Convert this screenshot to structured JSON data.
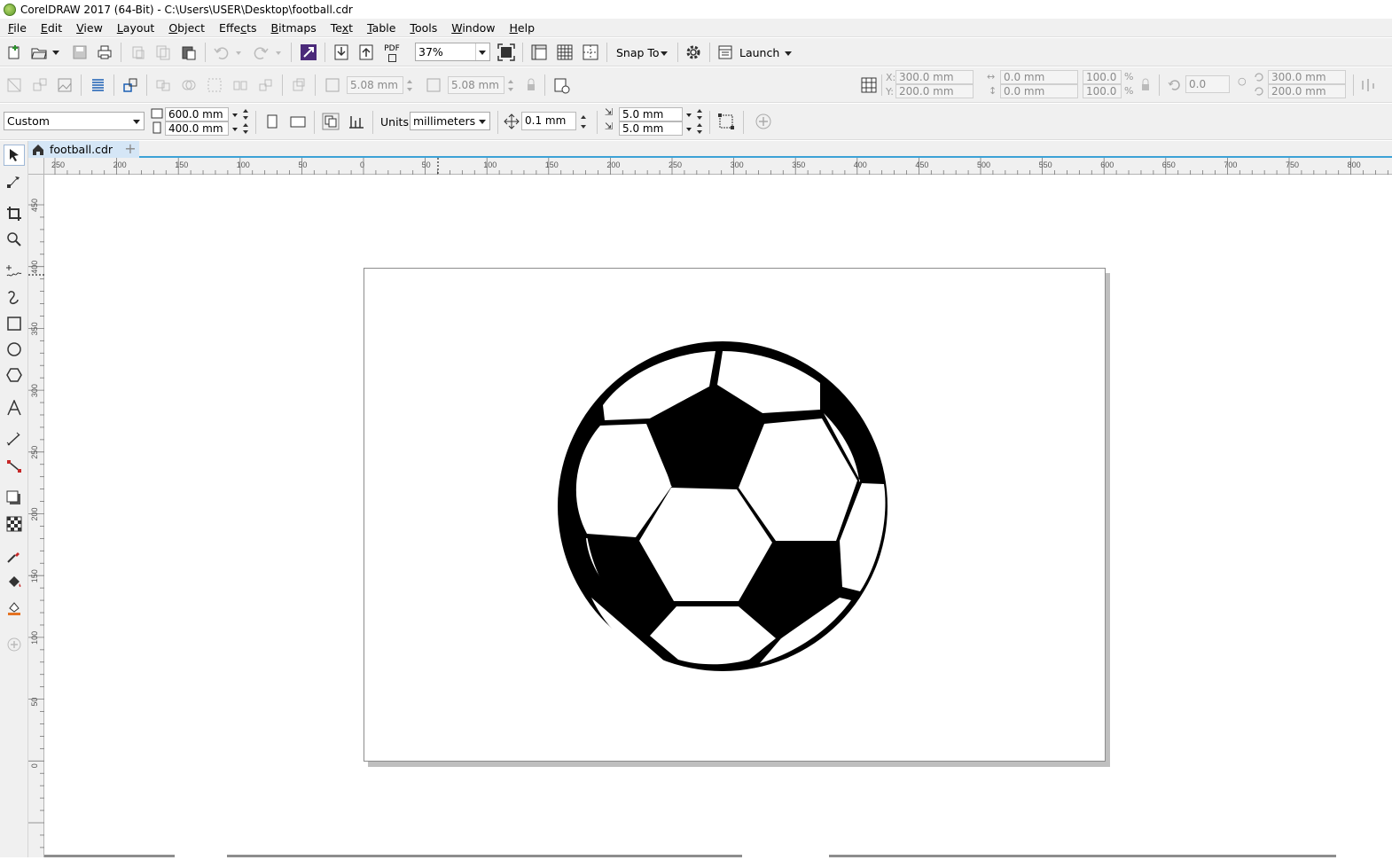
{
  "titlebar": {
    "title": "CorelDRAW 2017 (64-Bit) - C:\\Users\\USER\\Desktop\\football.cdr"
  },
  "menu": [
    {
      "label": "File",
      "u": "F",
      "rest": "ile"
    },
    {
      "label": "Edit",
      "u": "E",
      "rest": "dit"
    },
    {
      "label": "View",
      "u": "V",
      "rest": "iew"
    },
    {
      "label": "Layout",
      "u": "L",
      "rest": "ayout"
    },
    {
      "label": "Object",
      "u": "O",
      "rest": "bject"
    },
    {
      "label": "Effects",
      "u": "E",
      "rest": "ffects",
      "pre": ""
    },
    {
      "label": "Bitmaps",
      "u": "B",
      "rest": "itmaps"
    },
    {
      "label": "Text",
      "u": "T",
      "rest": "ext",
      "pre": "Te",
      "post": "t"
    },
    {
      "label": "Table",
      "u": "T",
      "rest": "able"
    },
    {
      "label": "Tools",
      "u": "T",
      "rest": "ools"
    },
    {
      "label": "Window",
      "u": "W",
      "rest": "indow"
    },
    {
      "label": "Help",
      "u": "H",
      "rest": "elp"
    }
  ],
  "standard_toolbar": {
    "pdf_label": "PDF",
    "zoom": "37%",
    "snap_to": "Snap To",
    "launch": "Launch"
  },
  "property_bar": {
    "nudge_h": "5.08 mm",
    "nudge_v": "5.08 mm",
    "x_label": "X:",
    "y_label": "Y:",
    "x": "300.0 mm",
    "y": "200.0 mm",
    "width": "0.0 mm",
    "height": "0.0 mm",
    "scale_w": "100.0",
    "scale_h": "100.0",
    "pct": "%",
    "rotation": "0.0",
    "center_x": "300.0 mm",
    "center_y": "200.0 mm"
  },
  "page_bar": {
    "page_preset": "Custom",
    "page_width": "600.0 mm",
    "page_height": "400.0 mm",
    "units_label": "Units:",
    "units": "millimeters",
    "nudge": "0.1 mm",
    "dup_x": "5.0 mm",
    "dup_y": "5.0 mm"
  },
  "document_tab": {
    "label": "football.cdr"
  },
  "rulers": {
    "horizontal_ticks": [
      "250",
      "200",
      "150",
      "100",
      "50",
      "0",
      "50",
      "100",
      "150",
      "200",
      "250",
      "300",
      "350",
      "400",
      "450",
      "500",
      "550",
      "600",
      "650",
      "700",
      "750",
      "800"
    ],
    "vertical_ticks": [
      "450",
      "400",
      "350",
      "300",
      "250",
      "200",
      "150",
      "100",
      "50",
      "0"
    ]
  },
  "icons": {
    "new": "new-document-icon",
    "open": "open-icon",
    "save": "save-icon",
    "print": "print-icon",
    "undo": "undo-icon",
    "redo": "redo-icon",
    "import": "import-icon",
    "export": "export-icon",
    "fullscreen": "full-screen-icon",
    "options": "gear-icon"
  },
  "colors": {
    "accent": "#3da2d6",
    "tab_active": "#d5e6f6",
    "ball": "#000000"
  }
}
